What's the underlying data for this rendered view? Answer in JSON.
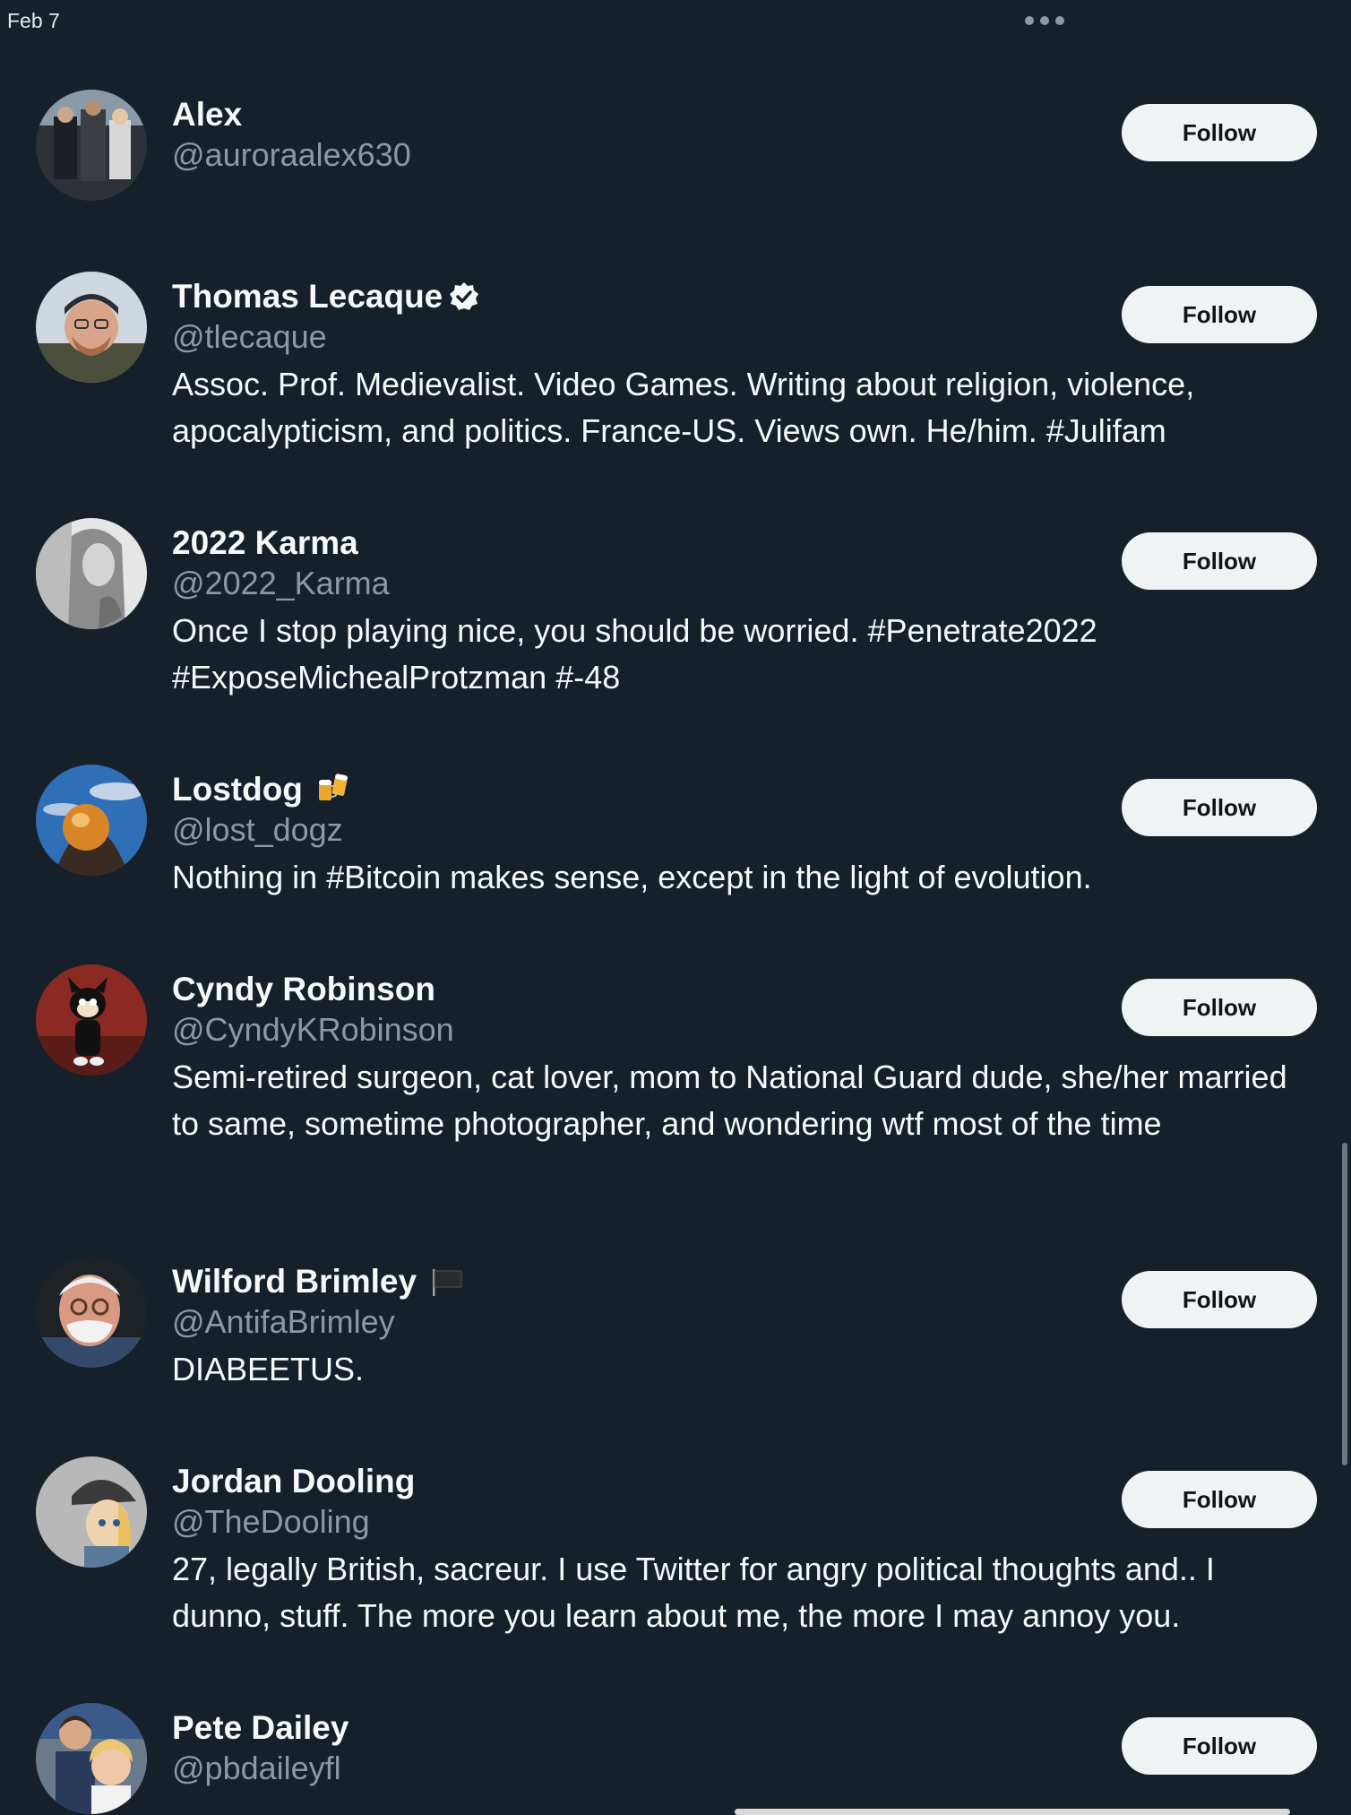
{
  "status_bar": {
    "date": "Feb 7"
  },
  "more_icon": "more-horizontal-icon",
  "follow_label": "Follow",
  "users": [
    {
      "name": "Alex",
      "handle": "@auroraalex630",
      "bio": "",
      "verified": false,
      "name_emoji": ""
    },
    {
      "name": "Thomas Lecaque",
      "handle": "@tlecaque",
      "bio": "Assoc. Prof. Medievalist. Video Games. Writing about religion, violence, apocalypticism, and politics. France-US. Views own. He/him. #Julifam",
      "verified": true,
      "name_emoji": ""
    },
    {
      "name": "2022 Karma",
      "handle": "@2022_Karma",
      "bio": "Once I stop playing nice, you should be worried. #Penetrate2022 #ExposeMichealProtzman #-48",
      "verified": false,
      "name_emoji": ""
    },
    {
      "name": "Lostdog",
      "handle": "@lost_dogz",
      "bio": "Nothing in #Bitcoin makes sense, except in the light of evolution.",
      "verified": false,
      "name_emoji": "beer-mugs"
    },
    {
      "name": "Cyndy Robinson",
      "handle": "@CyndyKRobinson",
      "bio": "Semi-retired surgeon, cat lover, mom to National Guard dude, she/her married to same, sometime photographer, and wondering wtf most of the time",
      "verified": false,
      "name_emoji": ""
    },
    {
      "name": "Wilford Brimley",
      "handle": "@AntifaBrimley",
      "bio": "DIABEETUS.",
      "verified": false,
      "name_emoji": "black-flag"
    },
    {
      "name": "Jordan Dooling",
      "handle": "@TheDooling",
      "bio": "27, legally British, sacreur. I use Twitter for angry political thoughts and.. I dunno, stuff. The more you learn about me, the more I may annoy you.",
      "verified": false,
      "name_emoji": ""
    },
    {
      "name": "Pete Dailey",
      "handle": "@pbdaileyfl",
      "bio": "",
      "verified": false,
      "name_emoji": ""
    }
  ],
  "colors": {
    "background": "#15202b",
    "text_primary": "#f7f9f9",
    "text_secondary": "#8b98a5",
    "button_bg": "#eff3f4",
    "button_text": "#0f1419"
  }
}
